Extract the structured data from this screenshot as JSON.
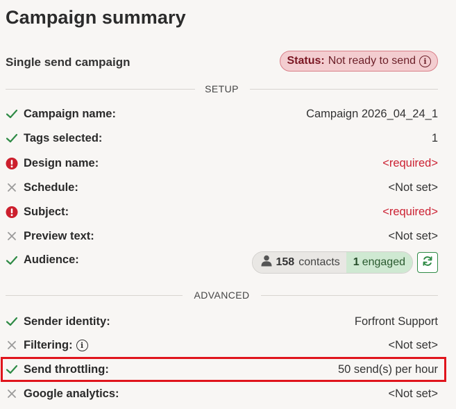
{
  "page_title": "Campaign summary",
  "campaign_type": "Single send campaign",
  "status": {
    "label": "Status:",
    "value": "Not ready to send",
    "info_icon": "info-icon"
  },
  "sections": {
    "setup": "SETUP",
    "advanced": "ADVANCED"
  },
  "setup_rows": [
    {
      "label": "Campaign name:",
      "value": "Campaign 2026_04_24_1",
      "state": "ok"
    },
    {
      "label": "Tags selected:",
      "value": "1",
      "state": "ok"
    },
    {
      "label": "Design name:",
      "value": "<required>",
      "state": "error"
    },
    {
      "label": "Schedule:",
      "value": "<Not set>",
      "state": "unset"
    },
    {
      "label": "Subject:",
      "value": "<required>",
      "state": "error"
    },
    {
      "label": "Preview text:",
      "value": "<Not set>",
      "state": "unset"
    }
  ],
  "audience": {
    "label": "Audience:",
    "state": "ok",
    "contacts_count": "158",
    "contacts_text": "contacts",
    "engaged_count": "1",
    "engaged_text": "engaged",
    "refresh_icon": "refresh-icon"
  },
  "advanced_rows": [
    {
      "label": "Sender identity:",
      "value": "Forfront Support",
      "state": "ok"
    },
    {
      "label": "Filtering:",
      "value": "<Not set>",
      "state": "unset",
      "has_info": true
    },
    {
      "label": "Send throttling:",
      "value": "50 send(s) per hour",
      "state": "ok",
      "highlighted": true
    },
    {
      "label": "Google analytics:",
      "value": "<Not set>",
      "state": "unset"
    }
  ],
  "colors": {
    "ok": "#2e8a45",
    "error": "#cc1f2d",
    "unset": "#9a9a9a",
    "status_bg": "#f3cdd0",
    "highlight": "#e0141c"
  }
}
